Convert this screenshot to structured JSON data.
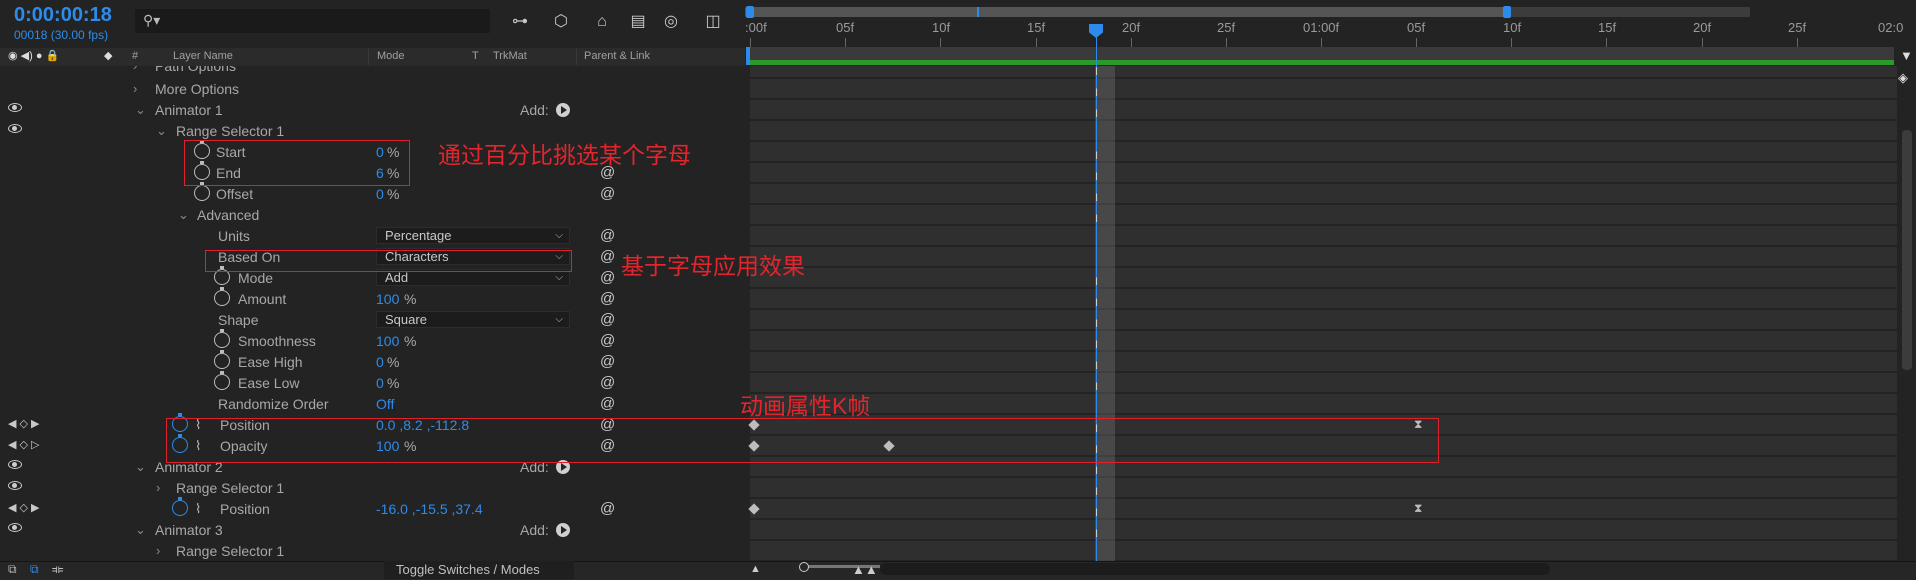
{
  "header": {
    "timecode": "0:00:00:18",
    "frame_info": "00018 (30.00 fps)",
    "search_placeholder": "",
    "toolbar_icons": [
      "composition-flowchart-icon",
      "draft-3d-icon",
      "shy-layers-icon",
      "frame-blending-icon",
      "motion-blur-icon",
      "graph-editor-icon"
    ]
  },
  "columns": {
    "hash": "#",
    "layer_name": "Layer Name",
    "mode": "Mode",
    "t": "T",
    "trkmat": "TrkMat",
    "parent": "Parent & Link"
  },
  "rows": [
    {
      "label": "Path Options",
      "indent": 1
    },
    {
      "label": "More Options",
      "indent": 1
    },
    {
      "label": "Animator 1",
      "add_label": "Add:"
    },
    {
      "label": "Range Selector 1"
    },
    {
      "label": "Start",
      "value": "0",
      "unit": "%"
    },
    {
      "label": "End",
      "value": "6",
      "unit": "%"
    },
    {
      "label": "Offset",
      "value": "0",
      "unit": "%"
    },
    {
      "label": "Advanced"
    },
    {
      "label": "Units",
      "dropdown": "Percentage"
    },
    {
      "label": "Based On",
      "dropdown": "Characters"
    },
    {
      "label": "Mode",
      "dropdown": "Add"
    },
    {
      "label": "Amount",
      "value": "100",
      "unit": "%"
    },
    {
      "label": "Shape",
      "dropdown": "Square"
    },
    {
      "label": "Smoothness",
      "value": "100",
      "unit": "%"
    },
    {
      "label": "Ease High",
      "value": "0",
      "unit": "%"
    },
    {
      "label": "Ease Low",
      "value": "0",
      "unit": "%"
    },
    {
      "label": "Randomize Order",
      "value": "Off"
    },
    {
      "label": "Position",
      "value": "0.0 ,8.2 ,-112.8"
    },
    {
      "label": "Opacity",
      "value": "100",
      "unit": "%"
    },
    {
      "label": "Animator 2",
      "add_label": "Add:"
    },
    {
      "label": "Range Selector 1"
    },
    {
      "label": "Position",
      "value": "-16.0 ,-15.5 ,37.4"
    },
    {
      "label": "Animator 3",
      "add_label": "Add:"
    },
    {
      "label": "Range Selector 1"
    }
  ],
  "annotations": {
    "note1": "通过百分比挑选某个字母",
    "note2": "基于字母应用效果",
    "note3": "动画属性K帧"
  },
  "ruler": {
    "ticks": [
      ":00f",
      "05f",
      "10f",
      "15f",
      "20f",
      "25f",
      "01:00f",
      "05f",
      "10f",
      "15f",
      "20f",
      "25f",
      "02:0"
    ]
  },
  "footer": {
    "toggle_label": "Toggle Switches / Modes"
  },
  "colors": {
    "accent": "#2d8ceb",
    "annotation": "#e4252d",
    "work_area": "#2a9a2a"
  }
}
